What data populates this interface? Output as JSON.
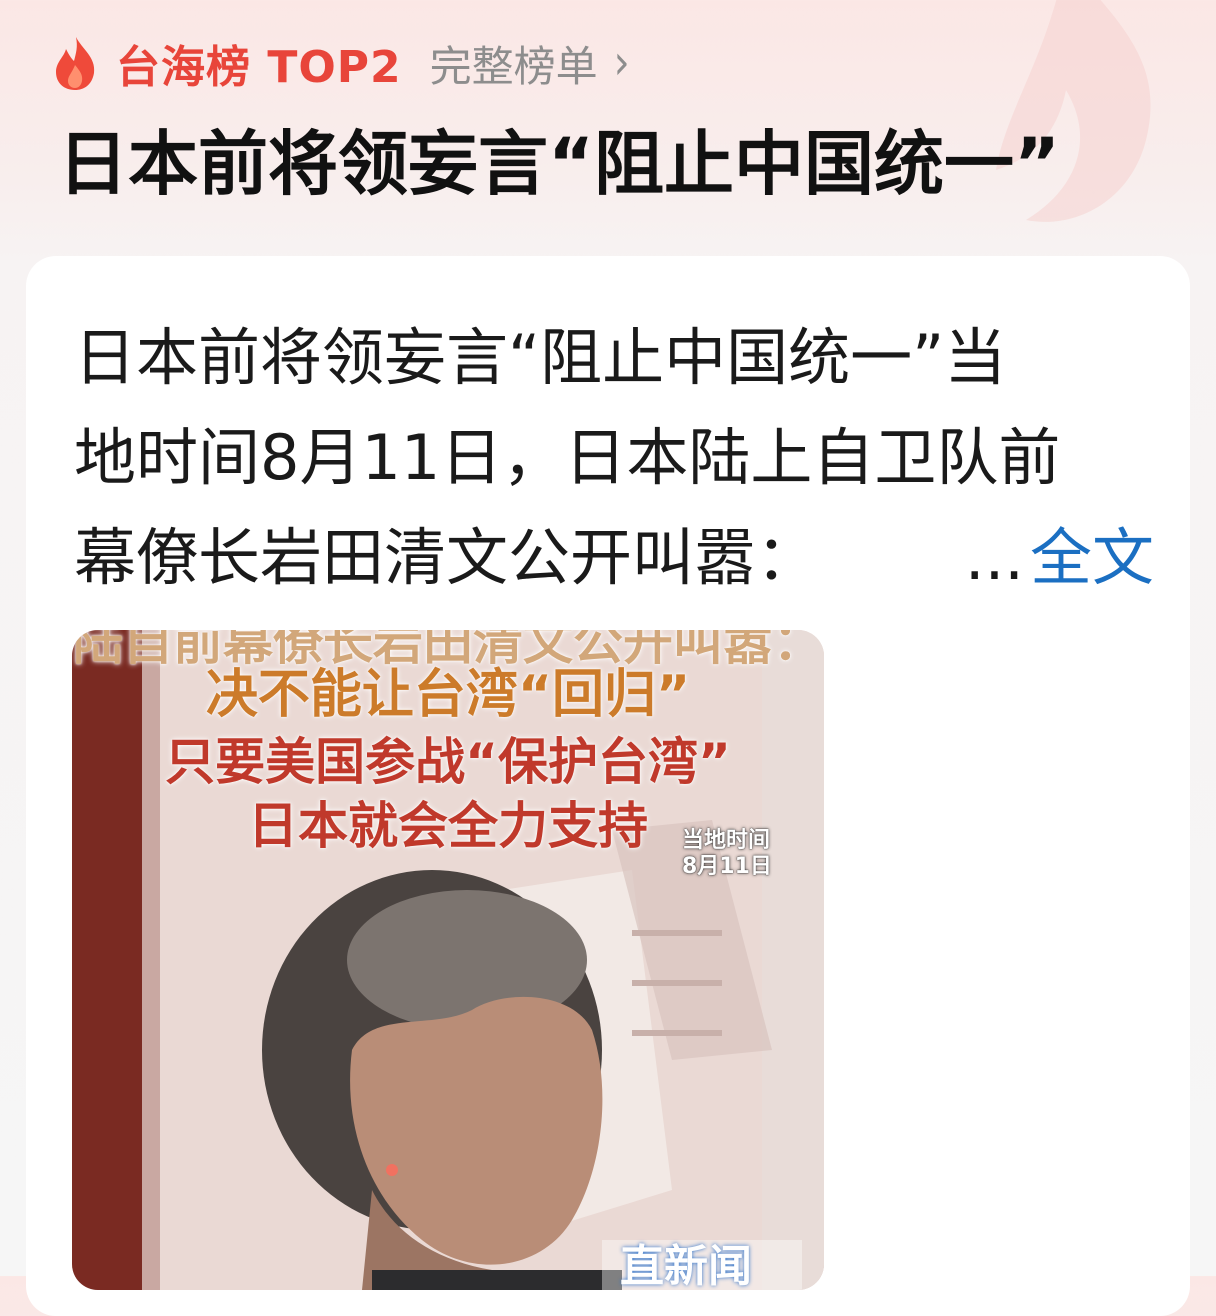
{
  "header": {
    "rank_label": "台海榜 TOP2",
    "full_list_label": "完整榜单",
    "chevron": "›"
  },
  "headline": "日本前将领妄言“阻止中国统一”",
  "summary": {
    "lines": [
      "日本前将领妄言“阻止中国统一”当",
      "地时间8月11日，日本陆上自卫队前",
      "幕僚长岩田清文公开叫嚣："
    ],
    "ellipsis": "...",
    "full_text_link": "全文"
  },
  "media": {
    "caption_top_partial": "陆自前幕僚长岩田清文公开叫嚣：",
    "caption_lines": [
      "决不能让台湾“回归”",
      "只要美国参战“保护台湾”",
      "日本就会全力支持"
    ],
    "timestamp_lines": [
      "当地时间",
      "8月11日"
    ],
    "watermark": "直新闻"
  },
  "colors": {
    "accent_red": "#e8453a",
    "link_blue": "#1b6fc2",
    "muted_gray": "#8d8d8d"
  },
  "icons": {
    "rank": "fire-icon",
    "more": "chevron-right-icon"
  }
}
